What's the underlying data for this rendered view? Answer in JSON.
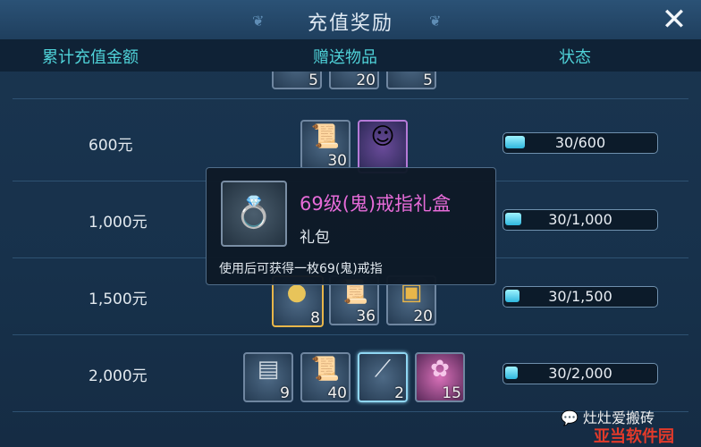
{
  "window": {
    "title": "充值奖励",
    "close_icon": "close-icon"
  },
  "columns": [
    "累计充值金额",
    "赠送物品",
    "状态"
  ],
  "rows": [
    {
      "amount": "",
      "items": [
        {
          "icon": "armor-icon",
          "count": "5"
        },
        {
          "icon": "heart-icon",
          "count": "20"
        },
        {
          "icon": "treasure-chest-icon",
          "count": "5"
        }
      ],
      "status": "",
      "progress": 0.05
    },
    {
      "amount": "600元",
      "items": [
        {
          "icon": "scroll-icon",
          "count": "30"
        },
        {
          "icon": "character-card-icon",
          "count": ""
        }
      ],
      "status": "30/600",
      "progress": 0.05
    },
    {
      "amount": "1,000元",
      "items": [],
      "status": "30/1,000",
      "progress": 0.03
    },
    {
      "amount": "1,500元",
      "items": [
        {
          "icon": "pearl-icon",
          "count": "8"
        },
        {
          "icon": "scroll-icon",
          "count": "36"
        },
        {
          "icon": "treasure-chest-icon",
          "count": "20"
        }
      ],
      "status": "30/1,500",
      "progress": 0.02
    },
    {
      "amount": "2,000元",
      "items": [
        {
          "icon": "paper-icon",
          "count": "9"
        },
        {
          "icon": "scroll-icon",
          "count": "40"
        },
        {
          "icon": "spear-icon",
          "count": "2"
        },
        {
          "icon": "flower-icon",
          "count": "15"
        }
      ],
      "status": "30/2,000",
      "progress": 0.015
    }
  ],
  "tooltip": {
    "name": "69级(鬼)戒指礼盒",
    "type": "礼包",
    "description": "使用后可获得一枚69(鬼)戒指",
    "icon": "ring-icon"
  },
  "watermark": {
    "line1": "灶灶爱搬砖",
    "line2": "亚当软件园"
  },
  "colors": {
    "header_text": "#4fd2d8",
    "tooltip_name": "#e66bd8",
    "progress_fill": "#2fb7de"
  }
}
